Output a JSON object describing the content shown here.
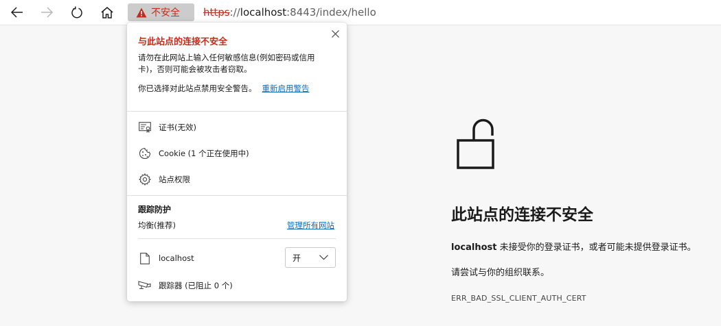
{
  "toolbar": {
    "security_label": "不安全",
    "url_scheme": "https",
    "url_sep": "://",
    "url_host": "localhost",
    "url_rest": ":8443/index/hello"
  },
  "popup": {
    "title": "与此站点的连接不安全",
    "description": "请勿在此网站上输入任何敏感信息(例如密码或信用卡)，否则可能会被攻击者窃取。",
    "disabled_text": "你已选择对此站点禁用安全警告。",
    "reenable_link": "重新启用警告",
    "certificate": "证书(无效)",
    "cookies": "Cookie (1 个正在使用中)",
    "site_permissions": "站点权限",
    "tracking": {
      "title": "跟踪防护",
      "level": "均衡(推荐)",
      "manage_link": "管理所有网站",
      "site": "localhost",
      "toggle_value": "开",
      "trackers": "跟踪器 (已阻止 0 个)"
    }
  },
  "error": {
    "title": "此站点的连接不安全",
    "host": "localhost",
    "message": " 未接受你的登录证书，或者可能未提供登录证书。",
    "suggestion": "请尝试与你的组织联系。",
    "code": "ERR_BAD_SSL_CLIENT_AUTH_CERT"
  },
  "colors": {
    "danger": "#c42b1c",
    "link": "#0f6cbd"
  }
}
